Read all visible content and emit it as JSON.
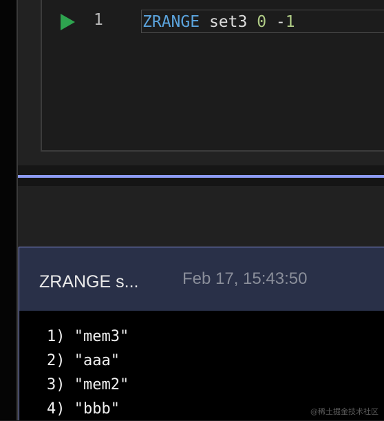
{
  "editor": {
    "line_number": "1",
    "code": {
      "keyword": "ZRANGE",
      "key": "set3",
      "start": "0",
      "stop": "-1"
    },
    "run_icon": "play-icon",
    "run_color": "#2ea44f"
  },
  "result": {
    "command_title": "ZRANGE s...",
    "timestamp": "Feb 17, 15:43:50",
    "rows": [
      {
        "index": "1)",
        "value": "\"mem3\""
      },
      {
        "index": "2)",
        "value": "\"aaa\""
      },
      {
        "index": "3)",
        "value": "\"mem2\""
      },
      {
        "index": "4)",
        "value": "\"bbb\""
      }
    ]
  },
  "watermark": "@稀土掘金技术社区",
  "colors": {
    "accent": "#8d9bf4",
    "header_bg": "#293048",
    "keyword": "#5ba3dc",
    "number": "#b0cc86"
  }
}
